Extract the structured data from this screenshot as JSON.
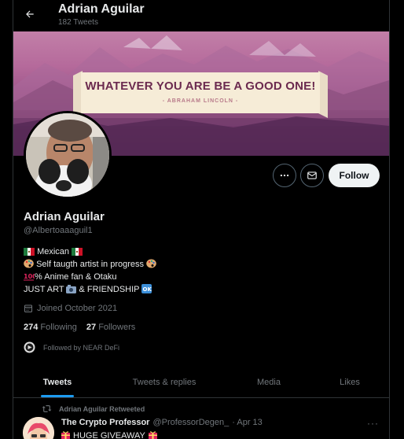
{
  "header": {
    "name": "Adrian Aguilar",
    "tweet_count": "182 Tweets"
  },
  "banner": {
    "quote": "WHATEVER YOU ARE BE A GOOD ONE!",
    "author": "- ABRAHAM LINCOLN -"
  },
  "profile": {
    "name": "Adrian Aguilar",
    "handle": "@Albertoaaaguil1",
    "bio": {
      "line1": "Mexican",
      "line2": "Self taugth artist in progress",
      "line3": "% Anime fan & Otaku",
      "line4_a": "JUST ART",
      "line4_b": "& FRIENDSHIP"
    },
    "joined": "Joined October 2021",
    "following_count": "274",
    "following_label": "Following",
    "followers_count": "27",
    "followers_label": "Followers",
    "followed_by": "Followed by NEAR DeFi"
  },
  "actions": {
    "follow": "Follow"
  },
  "tabs": [
    {
      "label": "Tweets"
    },
    {
      "label": "Tweets & replies"
    },
    {
      "label": "Media"
    },
    {
      "label": "Likes"
    }
  ],
  "tweet": {
    "retweet_note": "Adrian Aguilar Retweeted",
    "author": "The Crypto Professor",
    "handle": "@ProfessorDegen_",
    "date": "· Apr 13",
    "text": "HUGE GIVEAWAY",
    "more": "···"
  },
  "colors": {
    "accent": "#1d9bf0",
    "background": "#000000",
    "muted": "#71767b"
  },
  "icons": {
    "back": "arrow-left-icon",
    "more": "more-horizontal-icon",
    "message": "envelope-icon",
    "calendar": "calendar-icon",
    "retweet": "retweet-icon",
    "flag_mexico": "mexico-flag-icon",
    "palette": "artist-palette-icon",
    "hundred": "hundred-points-icon",
    "camera": "camera-icon",
    "ok": "ok-button-icon",
    "gift": "wrapped-gift-icon"
  }
}
